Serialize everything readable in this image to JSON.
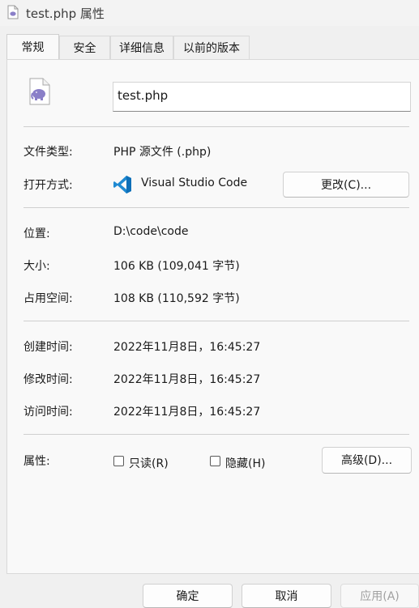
{
  "window": {
    "title": "test.php 属性",
    "title_icon": "php-file-icon"
  },
  "tabs": [
    {
      "label": "常规",
      "active": true
    },
    {
      "label": "安全",
      "active": false
    },
    {
      "label": "详细信息",
      "active": false
    },
    {
      "label": "以前的版本",
      "active": false
    }
  ],
  "general": {
    "file_icon": "php-elephant-file-icon",
    "file_name": "test.php",
    "file_type_label": "文件类型:",
    "file_type_value": "PHP 源文件 (.php)",
    "open_with_label": "打开方式:",
    "open_with_app": "Visual Studio Code",
    "open_with_icon": "vscode-icon",
    "change_button": "更改(C)...",
    "location_label": "位置:",
    "location_value": "D:\\code\\code",
    "size_label": "大小:",
    "size_value": "106 KB (109,041 字节)",
    "size_on_disk_label": "占用空间:",
    "size_on_disk_value": "108 KB (110,592 字节)",
    "created_label": "创建时间:",
    "created_value": "2022年11月8日，16:45:27",
    "modified_label": "修改时间:",
    "modified_value": "2022年11月8日，16:45:27",
    "accessed_label": "访问时间:",
    "accessed_value": "2022年11月8日，16:45:27",
    "attributes_label": "属性:",
    "readonly_label": "只读(R)",
    "readonly_checked": false,
    "hidden_label": "隐藏(H)",
    "hidden_checked": false,
    "advanced_button": "高级(D)..."
  },
  "footer": {
    "ok_button": "确定",
    "cancel_button": "取消",
    "apply_button": "应用(A)",
    "apply_disabled": true
  },
  "colors": {
    "php_purple": "#8a7fc8",
    "vscode_blue": "#1f8ad2"
  }
}
